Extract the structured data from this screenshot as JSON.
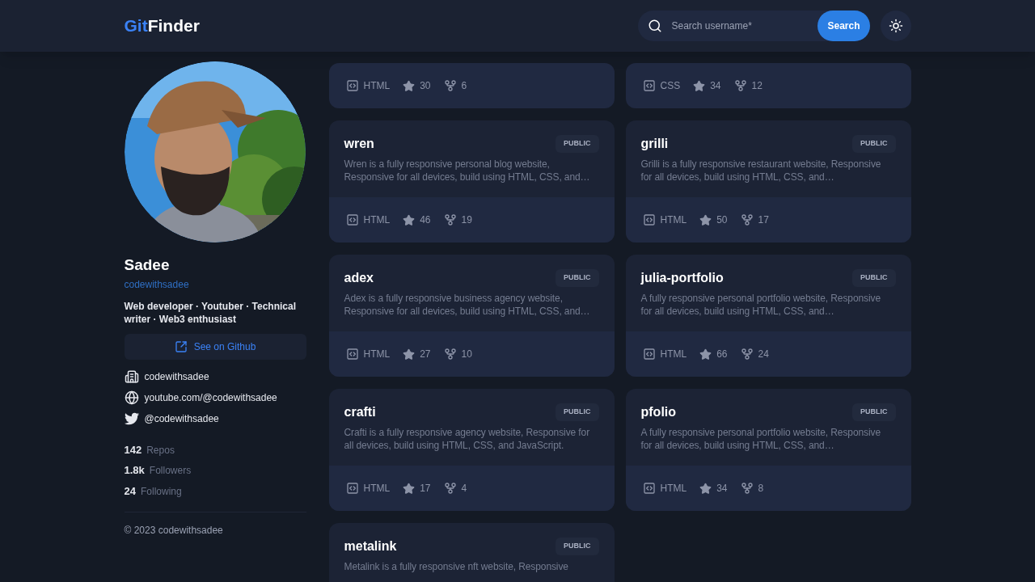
{
  "header": {
    "logo": {
      "accent": "Git",
      "rest": "Finder"
    },
    "search": {
      "placeholder": "Search username*"
    },
    "search_button": "Search"
  },
  "profile": {
    "name": "Sadee",
    "username": "codewithsadee",
    "bio": "Web developer · Youtuber · Technical writer · Web3 enthusiast",
    "github_button": "See on Github",
    "links": [
      {
        "kind": "company",
        "text": "codewithsadee"
      },
      {
        "kind": "website",
        "text": "youtube.com/@codewithsadee"
      },
      {
        "kind": "twitter",
        "text": "@codewithsadee"
      }
    ],
    "stats": [
      {
        "value": "142",
        "label": "Repos"
      },
      {
        "value": "1.8k",
        "label": "Followers"
      },
      {
        "value": "24",
        "label": "Following"
      }
    ],
    "copyright": "© 2023 codewithsadee"
  },
  "repos": [
    {
      "language": "HTML",
      "star_count": "30",
      "fork_count": "6"
    },
    {
      "language": "CSS",
      "star_count": "34",
      "fork_count": "12"
    },
    {
      "name": "wren",
      "visibility": "PUBLIC",
      "description": "Wren is a fully responsive personal blog website, Responsive for all devices, build using HTML, CSS, and…",
      "language": "HTML",
      "star_count": "46",
      "fork_count": "19"
    },
    {
      "name": "grilli",
      "visibility": "PUBLIC",
      "description": "Grilli is a fully responsive restaurant website, Responsive for all devices, build using HTML, CSS, and…",
      "language": "HTML",
      "star_count": "50",
      "fork_count": "17"
    },
    {
      "name": "adex",
      "visibility": "PUBLIC",
      "description": "Adex is a fully responsive business agency website, Responsive for all devices, build using HTML, CSS, and…",
      "language": "HTML",
      "star_count": "27",
      "fork_count": "10"
    },
    {
      "name": "julia-portfolio",
      "visibility": "PUBLIC",
      "description": "A fully responsive personal portfolio website, Responsive for all devices, build using HTML, CSS, and…",
      "language": "HTML",
      "star_count": "66",
      "fork_count": "24"
    },
    {
      "name": "crafti",
      "visibility": "PUBLIC",
      "description": "Crafti is a fully responsive agency website, Responsive for all devices, build using HTML, CSS, and JavaScript.",
      "language": "HTML",
      "star_count": "17",
      "fork_count": "4"
    },
    {
      "name": "pfolio",
      "visibility": "PUBLIC",
      "description": "A fully responsive personal portfolio website, Responsive for all devices, build using HTML, CSS, and…",
      "language": "HTML",
      "star_count": "34",
      "fork_count": "8"
    },
    {
      "name": "metalink",
      "visibility": "PUBLIC",
      "description": "Metalink is a fully responsive nft website, Responsive"
    }
  ]
}
